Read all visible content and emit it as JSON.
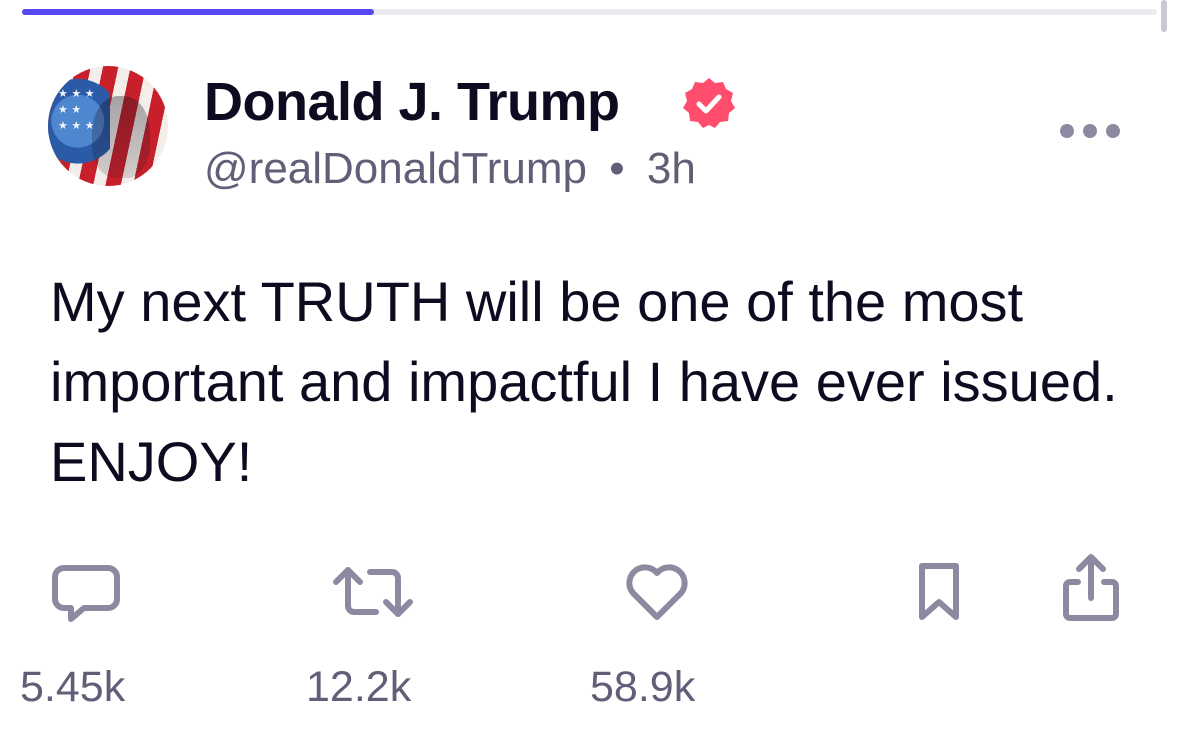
{
  "header": {
    "progress_fraction": 0.31
  },
  "post": {
    "author": {
      "display_name": "Donald J. Trump",
      "handle": "@realDonaldTrump",
      "separator": "•",
      "time": "3h",
      "verified": true,
      "verified_color": "#ff4d6d",
      "avatar_icon": "american-flag-portrait"
    },
    "text": "My next TRUTH will be one of the most important and impactful I have ever issued. ENJOY!",
    "actions": {
      "reply_count": "5.45k",
      "retruth_count": "12.2k",
      "like_count": "58.9k"
    }
  },
  "colors": {
    "accent": "#5448ee",
    "icon": "#8c8aa0",
    "text_primary": "#0d0b1f",
    "text_secondary": "#615f78"
  }
}
